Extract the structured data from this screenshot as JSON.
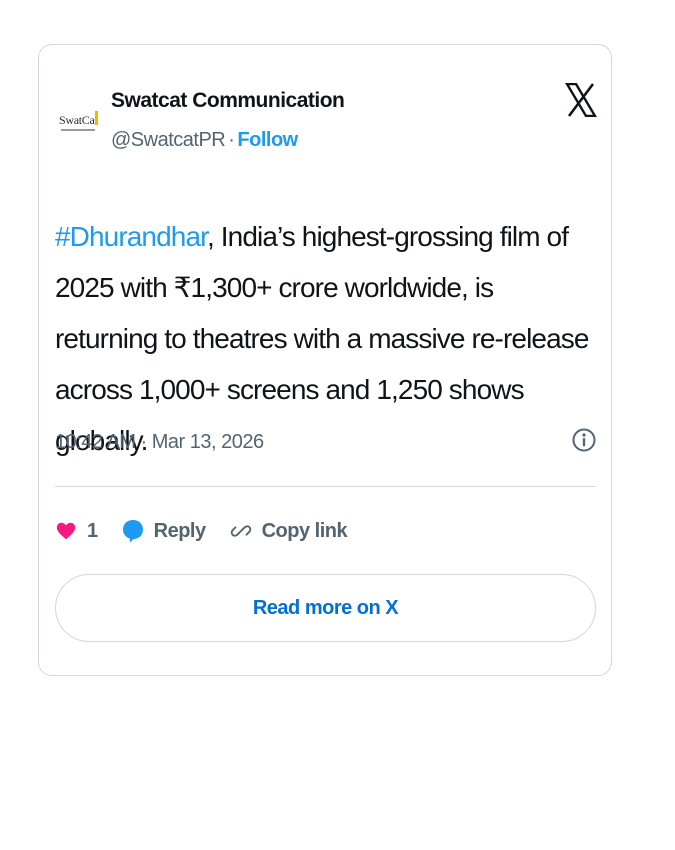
{
  "tweet": {
    "author": {
      "name": "Swatcat Communication",
      "handle": "@SwatcatPR",
      "separator": "·",
      "follow_label": "Follow",
      "avatar_text": "SwatCat"
    },
    "brand_icon": "x-logo-icon",
    "text": {
      "hashtag": "#Dhurandhar",
      "body": ", India’s highest-grossing film of 2025 with ₹1,300+ crore worldwide, is returning to theatres with a massive re-release across 1,000+ screens and 1,250 shows globally."
    },
    "timestamp": "10:42 AM · Mar 13, 2026",
    "info_icon": "info-icon",
    "actions": {
      "like_count": "1",
      "reply_label": "Reply",
      "copy_link_label": "Copy link"
    },
    "read_more_label": "Read more on X"
  },
  "colors": {
    "accent": "#1d9bf0",
    "link_dark": "#006fd6",
    "like": "#f91880",
    "secondary_text": "#536471",
    "border": "#cfd9de"
  }
}
